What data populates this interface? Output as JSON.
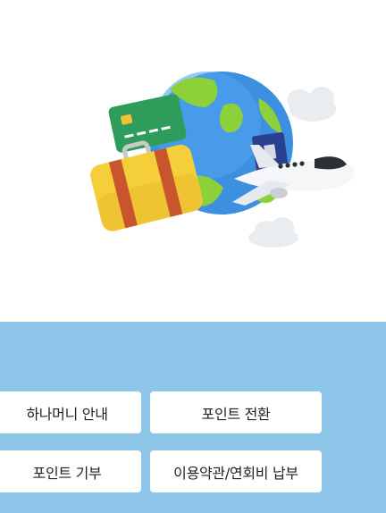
{
  "theme": {
    "panel_color": "#8dc5e8",
    "button_bg": "#ffffff",
    "text_color": "#222222"
  },
  "hero": {
    "image_icon": "travel-globe-illustration"
  },
  "menu": {
    "buttons": [
      {
        "label": "하나머니 안내"
      },
      {
        "label": "포인트 전환"
      },
      {
        "label": "포인트 기부"
      },
      {
        "label": "이용약관/연회비 납부"
      }
    ]
  }
}
